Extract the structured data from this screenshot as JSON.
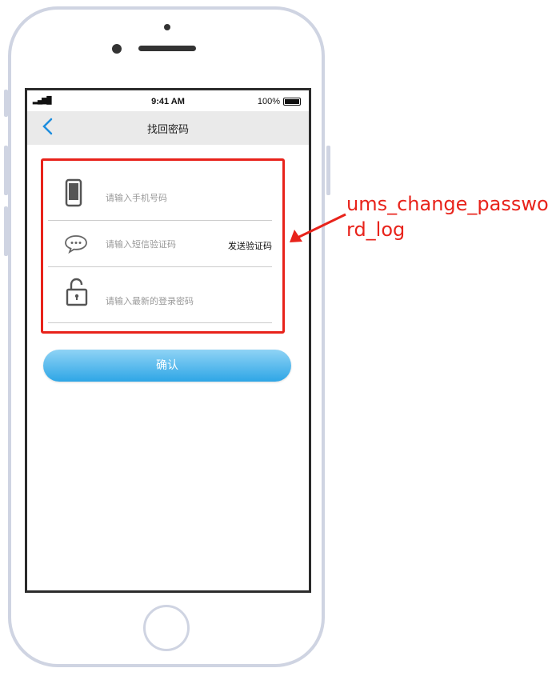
{
  "status_bar": {
    "signal": "▂▄▆█",
    "time": "9:41 AM",
    "battery": "100%"
  },
  "nav": {
    "back_icon": "chevron-left-icon",
    "title": "找回密码"
  },
  "form": {
    "phone_placeholder": "请输入手机号码",
    "sms_placeholder": "请输入短信验证码",
    "send_code_label": "发送验证码",
    "password_placeholder": "请输入最新的登录密码",
    "confirm_label": "确认"
  },
  "annotation": {
    "label": "ums_change_password_log"
  },
  "colors": {
    "accent": "#1e8ede",
    "annotation": "#e8231b",
    "button_gradient_top": "#8fd3f5",
    "button_gradient_bottom": "#2ea6e6"
  }
}
